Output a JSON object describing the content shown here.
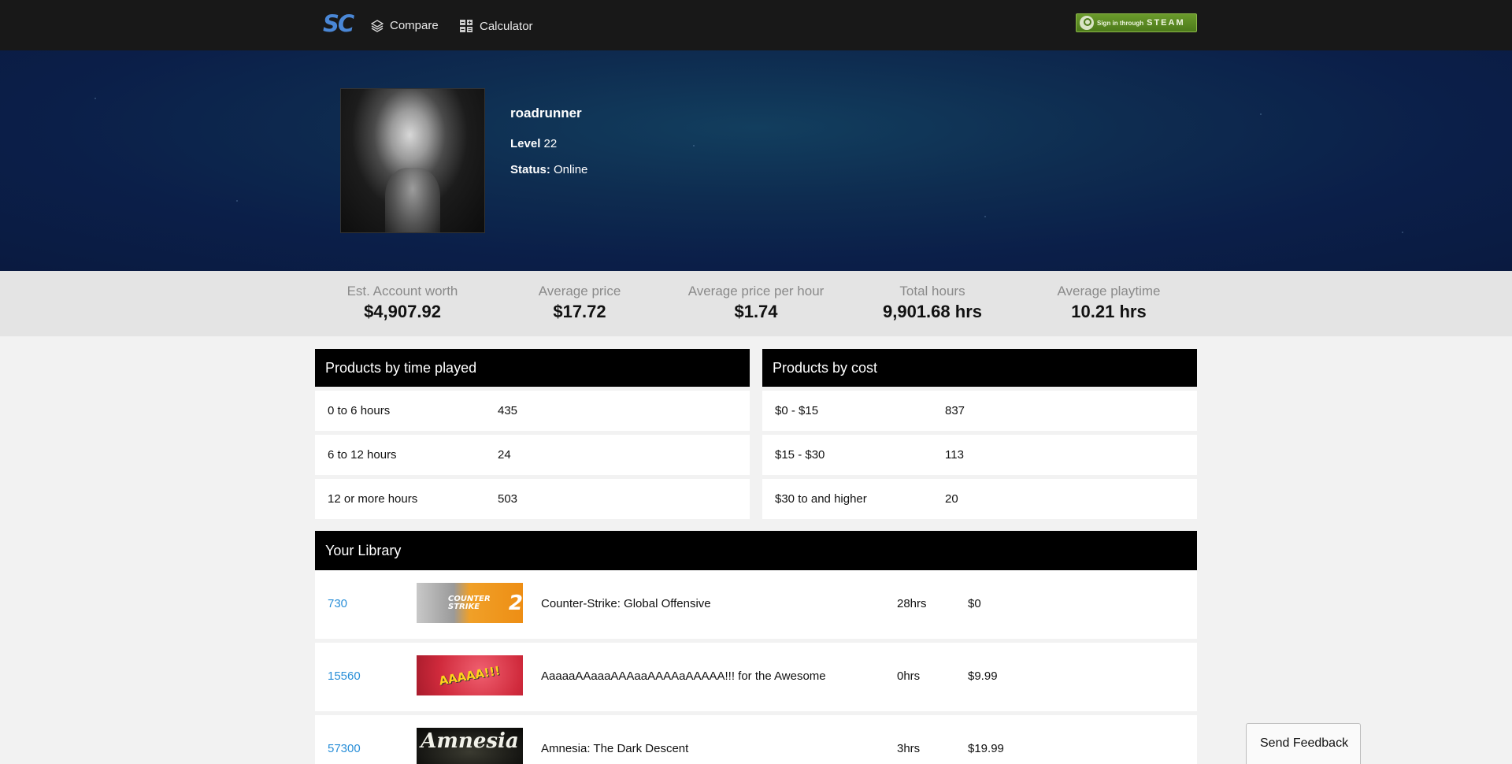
{
  "nav": {
    "brand": "SC",
    "compare_label": "Compare",
    "calculator_label": "Calculator",
    "steam_small": "Sign in through",
    "steam_word": "STEAM"
  },
  "profile": {
    "name": "roadrunner",
    "level_label": "Level",
    "level_value": "22",
    "status_label": "Status:",
    "status_value": "Online"
  },
  "stats": [
    {
      "label": "Est. Account worth",
      "value": "$4,907.92"
    },
    {
      "label": "Average price",
      "value": "$17.72"
    },
    {
      "label": "Average price per hour",
      "value": "$1.74"
    },
    {
      "label": "Total hours",
      "value": "9,901.68 hrs"
    },
    {
      "label": "Average playtime",
      "value": "10.21 hrs"
    }
  ],
  "time_panel": {
    "title": "Products by time played",
    "rows": [
      {
        "label": "0 to 6 hours",
        "value": "435"
      },
      {
        "label": "6 to 12 hours",
        "value": "24"
      },
      {
        "label": "12 or more hours",
        "value": "503"
      }
    ]
  },
  "cost_panel": {
    "title": "Products by cost",
    "rows": [
      {
        "label": "$0 - $15",
        "value": "837"
      },
      {
        "label": "$15 - $30",
        "value": "113"
      },
      {
        "label": "$30 to and higher",
        "value": "20"
      }
    ]
  },
  "library": {
    "title": "Your Library",
    "items": [
      {
        "id": "730",
        "title": "Counter-Strike: Global Offensive",
        "hours": "28hrs",
        "price": "$0",
        "thumb_text": "COUNTER STRIKE",
        "thumb_num": "2"
      },
      {
        "id": "15560",
        "title": "AaaaaAAaaaAAAaaAAAAaAAAAA!!! for the Awesome",
        "hours": "0hrs",
        "price": "$9.99",
        "thumb_text": "AAAAA!!!"
      },
      {
        "id": "57300",
        "title": "Amnesia: The Dark Descent",
        "hours": "3hrs",
        "price": "$19.99",
        "thumb_text": "Amnesia"
      }
    ]
  },
  "feedback_label": "Send Feedback",
  "colors": {
    "navbar": "#181818",
    "brand": "#4a87d6",
    "steam_green": "#5a8a22",
    "hero": "#0e2c50",
    "stats_bg": "#e4e4e4",
    "panel_head": "#000000",
    "link": "#2a8fd8"
  }
}
